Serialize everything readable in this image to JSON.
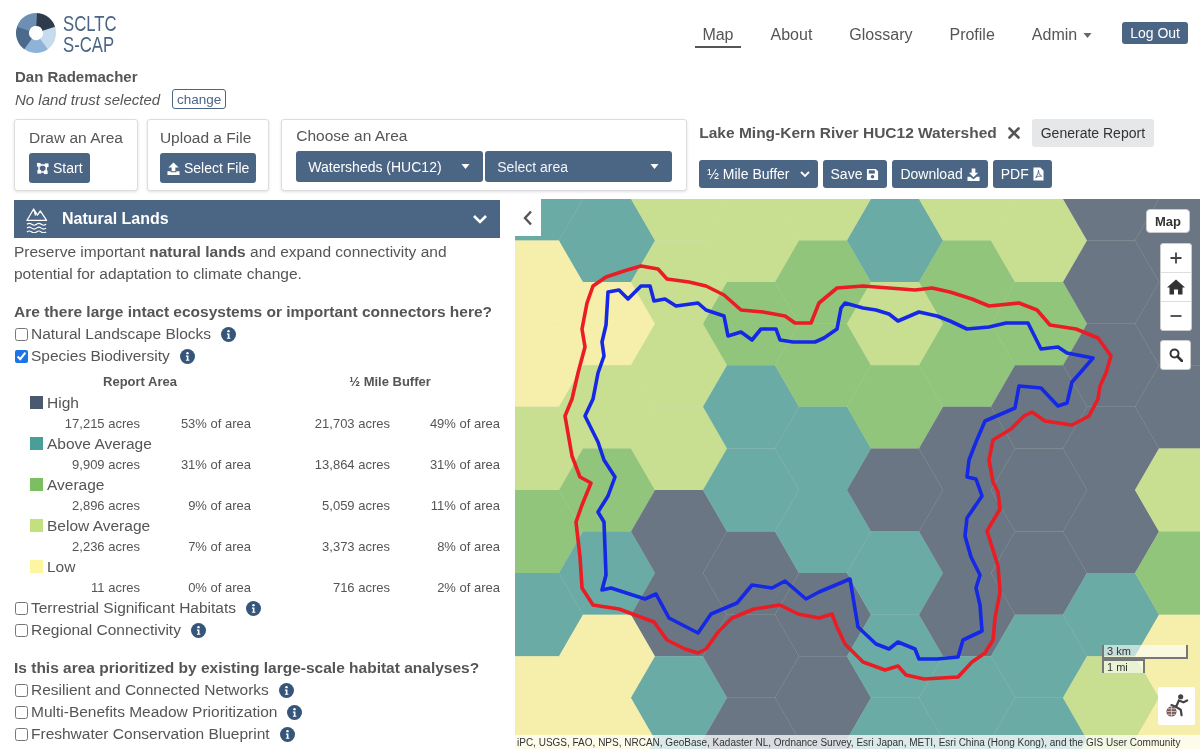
{
  "header": {
    "logo": [
      "SCLTC",
      "S-CAP"
    ],
    "nav": [
      {
        "label": "Map",
        "kind": "link",
        "selected": true
      },
      {
        "label": "About",
        "kind": "link",
        "selected": false
      },
      {
        "label": "Glossary",
        "kind": "link",
        "selected": false
      },
      {
        "label": "Profile",
        "kind": "link",
        "selected": false
      },
      {
        "label": "Admin",
        "kind": "dropdown",
        "selected": false
      }
    ],
    "logout": "Log Out"
  },
  "user": {
    "name": "Dan Rademacher",
    "land_trust": "No land trust selected",
    "change": "change"
  },
  "tools": [
    {
      "kind": "draw",
      "title": "Draw an Area",
      "button": "Start"
    },
    {
      "kind": "upload",
      "title": "Upload a File",
      "button": "Select File"
    },
    {
      "kind": "choose",
      "title": "Choose an Area",
      "selects": [
        {
          "value": "Watersheds (HUC12)"
        },
        {
          "placeholder": "Select area"
        }
      ]
    }
  ],
  "area": {
    "title": "Lake Ming-Kern River HUC12 Watershed",
    "generate": "Generate Report",
    "buffer": {
      "value": "½ Mile Buffer"
    },
    "actions": [
      {
        "kind": "save",
        "label": "Save"
      },
      {
        "kind": "download",
        "label": "Download"
      },
      {
        "kind": "pdf",
        "label": "PDF"
      }
    ]
  },
  "section": {
    "title": "Natural Lands",
    "expanded": true,
    "description": "Preserve important **natural lands** and expand connectivity and potential for adaptation to climate change.",
    "groups": [
      {
        "question": "Are there large intact ecosystems or important connectors here?",
        "layers": [
          {
            "label": "Natural Landscape Blocks",
            "checked": false
          },
          {
            "label": "Species Biodiversity",
            "checked": true,
            "table": {
              "columns": [
                "Report Area",
                "½ Mile Buffer"
              ],
              "rows": [
                {
                  "label": "High",
                  "color": "#4a5a6e",
                  "report_acres": "17,215 acres",
                  "report_percent": "53% of area",
                  "buffer_acres": "21,703 acres",
                  "buffer_percent": "49% of area"
                },
                {
                  "label": "Above Average",
                  "color": "#4a9e9a",
                  "report_acres": "9,909 acres",
                  "report_percent": "31% of area",
                  "buffer_acres": "13,864 acres",
                  "buffer_percent": "31% of area"
                },
                {
                  "label": "Average",
                  "color": "#7cbf63",
                  "report_acres": "2,896 acres",
                  "report_percent": "9% of area",
                  "buffer_acres": "5,059 acres",
                  "buffer_percent": "11% of area"
                },
                {
                  "label": "Below Average",
                  "color": "#c3e07f",
                  "report_acres": "2,236 acres",
                  "report_percent": "7% of area",
                  "buffer_acres": "3,373 acres",
                  "buffer_percent": "8% of area"
                },
                {
                  "label": "Low",
                  "color": "#fdf5a0",
                  "report_acres": "11 acres",
                  "report_percent": "0% of area",
                  "buffer_acres": "716 acres",
                  "buffer_percent": "2% of area"
                }
              ]
            }
          },
          {
            "label": "Terrestrial Significant Habitats",
            "checked": false
          },
          {
            "label": "Regional Connectivity",
            "checked": false
          }
        ]
      },
      {
        "question": "Is this area prioritized by existing large-scale habitat analyses?",
        "layers": [
          {
            "label": "Resilient and Connected Networks",
            "checked": false
          },
          {
            "label": "Multi-Benefits Meadow Prioritization",
            "checked": false
          },
          {
            "label": "Freshwater Conservation Blueprint",
            "checked": false
          }
        ]
      }
    ]
  },
  "map": {
    "basemap": "Map",
    "scale": [
      "3 km",
      "1 mi"
    ],
    "attribution": "iPC, USGS, FAO, NPS, NRCAN, GeoBase, Kadaster NL, Ordnance Survey, Esri Japan, METI, Esri China (Hong Kong), and the GIS User Community"
  }
}
